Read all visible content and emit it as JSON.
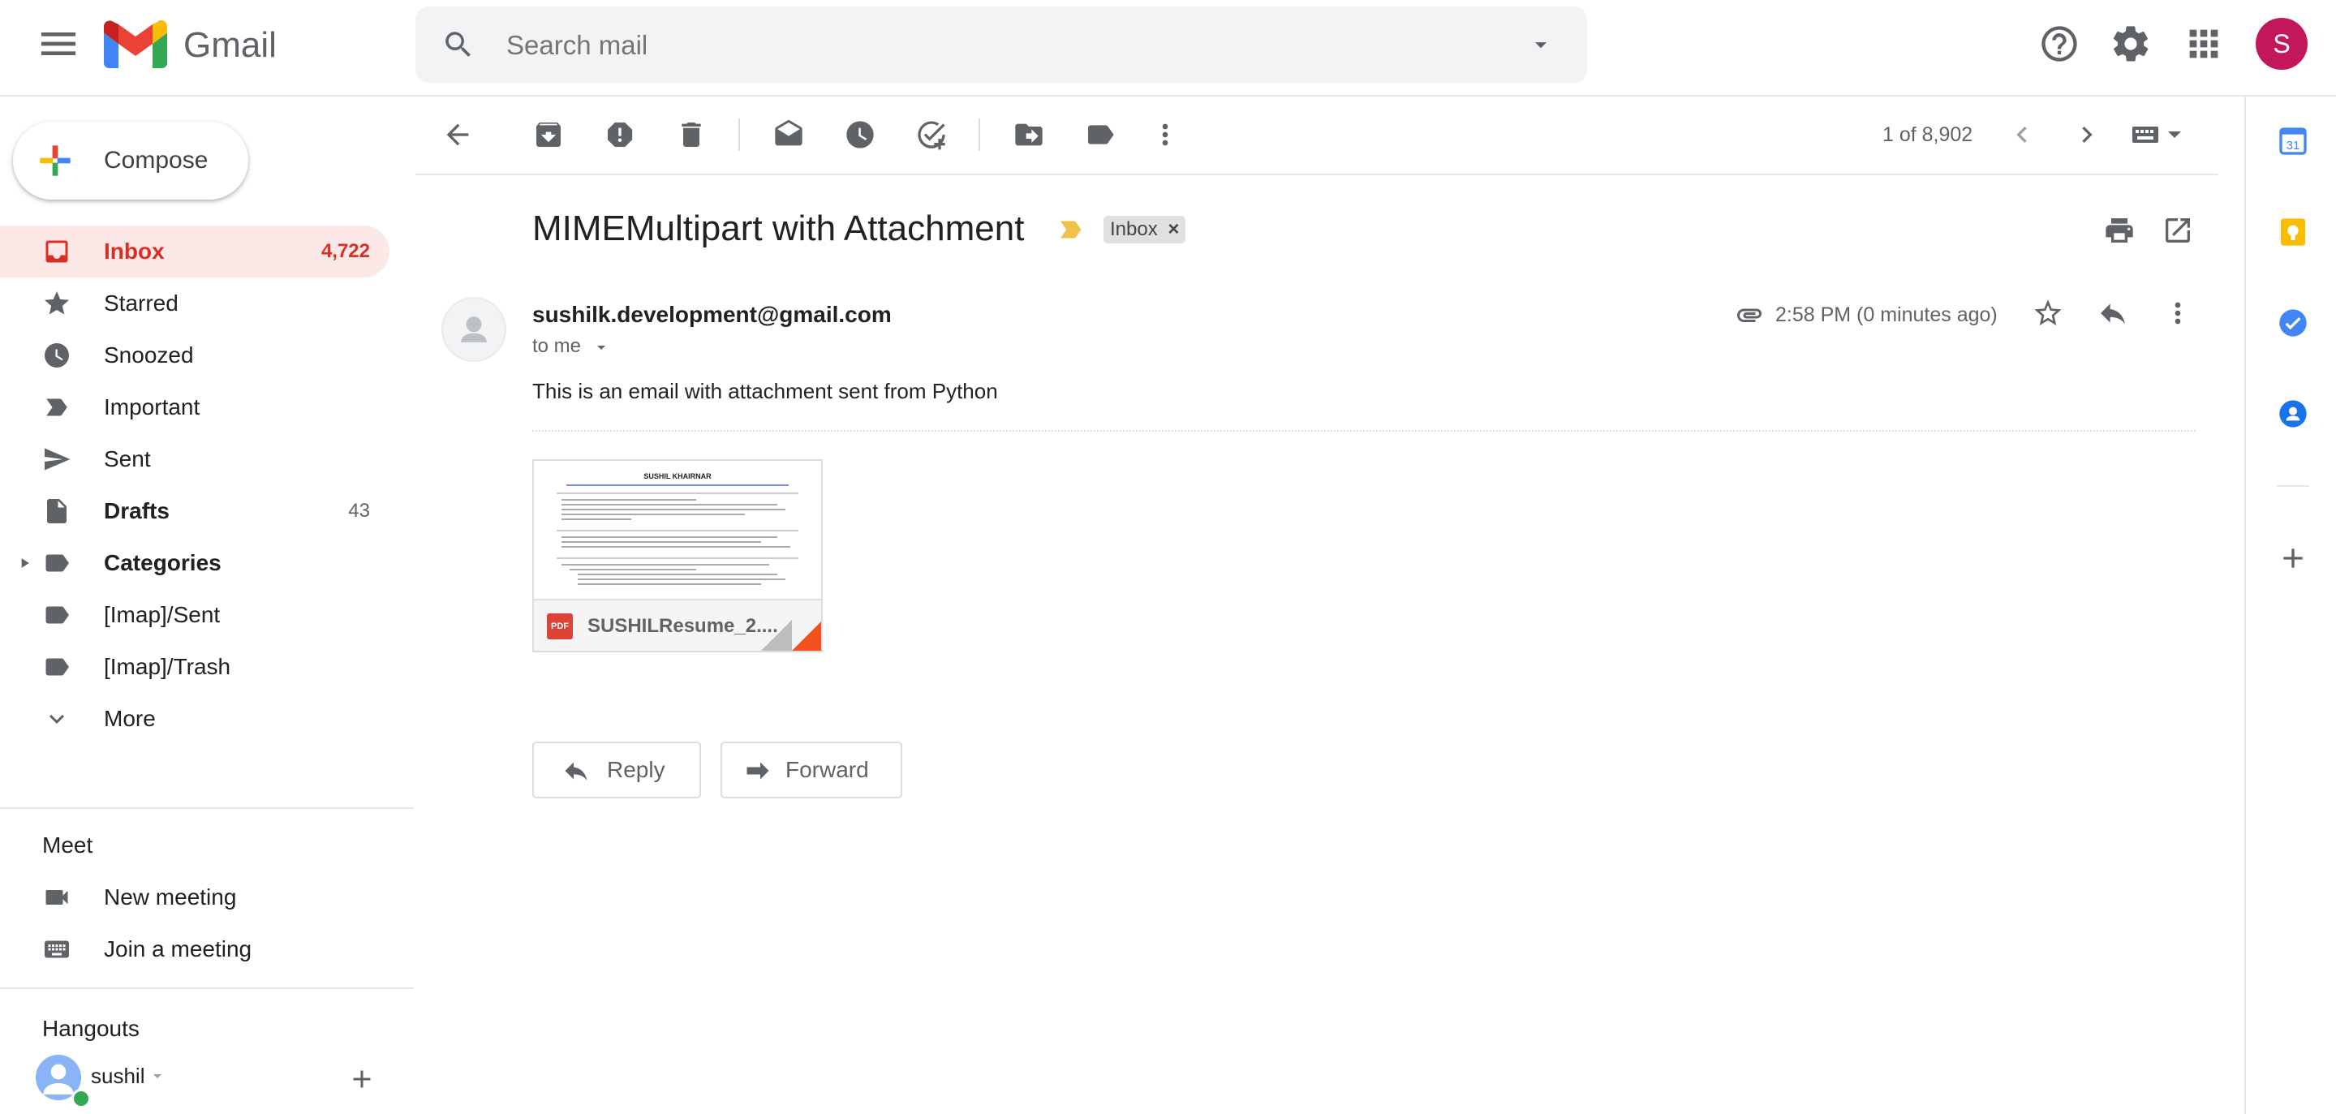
{
  "app": {
    "name": "Gmail"
  },
  "search": {
    "placeholder": "Search mail"
  },
  "user": {
    "initial": "S"
  },
  "compose": {
    "label": "Compose"
  },
  "sidebar": {
    "items": [
      {
        "label": "Inbox",
        "count": "4,722",
        "icon": "inbox-icon"
      },
      {
        "label": "Starred",
        "count": "",
        "icon": "star-icon"
      },
      {
        "label": "Snoozed",
        "count": "",
        "icon": "clock-icon"
      },
      {
        "label": "Important",
        "count": "",
        "icon": "important-icon"
      },
      {
        "label": "Sent",
        "count": "",
        "icon": "send-icon"
      },
      {
        "label": "Drafts",
        "count": "43",
        "icon": "draft-icon"
      },
      {
        "label": "Categories",
        "count": "",
        "icon": "label-icon"
      },
      {
        "label": "[Imap]/Sent",
        "count": "",
        "icon": "label-icon"
      },
      {
        "label": "[Imap]/Trash",
        "count": "",
        "icon": "label-icon"
      },
      {
        "label": "More",
        "count": "",
        "icon": "chevron-down-icon"
      }
    ]
  },
  "meet": {
    "title": "Meet",
    "items": [
      {
        "label": "New meeting",
        "icon": "video-icon"
      },
      {
        "label": "Join a meeting",
        "icon": "keyboard-icon"
      }
    ]
  },
  "hangouts": {
    "title": "Hangouts",
    "user": "sushil"
  },
  "toolbar": {
    "pager": "1 of 8,902"
  },
  "message": {
    "subject": "MIMEMultipart with Attachment",
    "label_chip": "Inbox",
    "label_chip_close": "×",
    "sender": "sushilk.development@gmail.com",
    "to": "to me",
    "time": "2:58 PM (0 minutes ago)",
    "body": "This is an email with attachment sent from Python",
    "attachment": {
      "name": "SUSHILResume_2....",
      "type": "PDF",
      "preview_title": "SUSHIL KHAIRNAR"
    },
    "reply_label": "Reply",
    "forward_label": "Forward"
  },
  "colors": {
    "accent": "#d93025",
    "active_bg": "#fce8e6",
    "avatar": "#c2185b",
    "important_marker": "#f0c14b"
  }
}
